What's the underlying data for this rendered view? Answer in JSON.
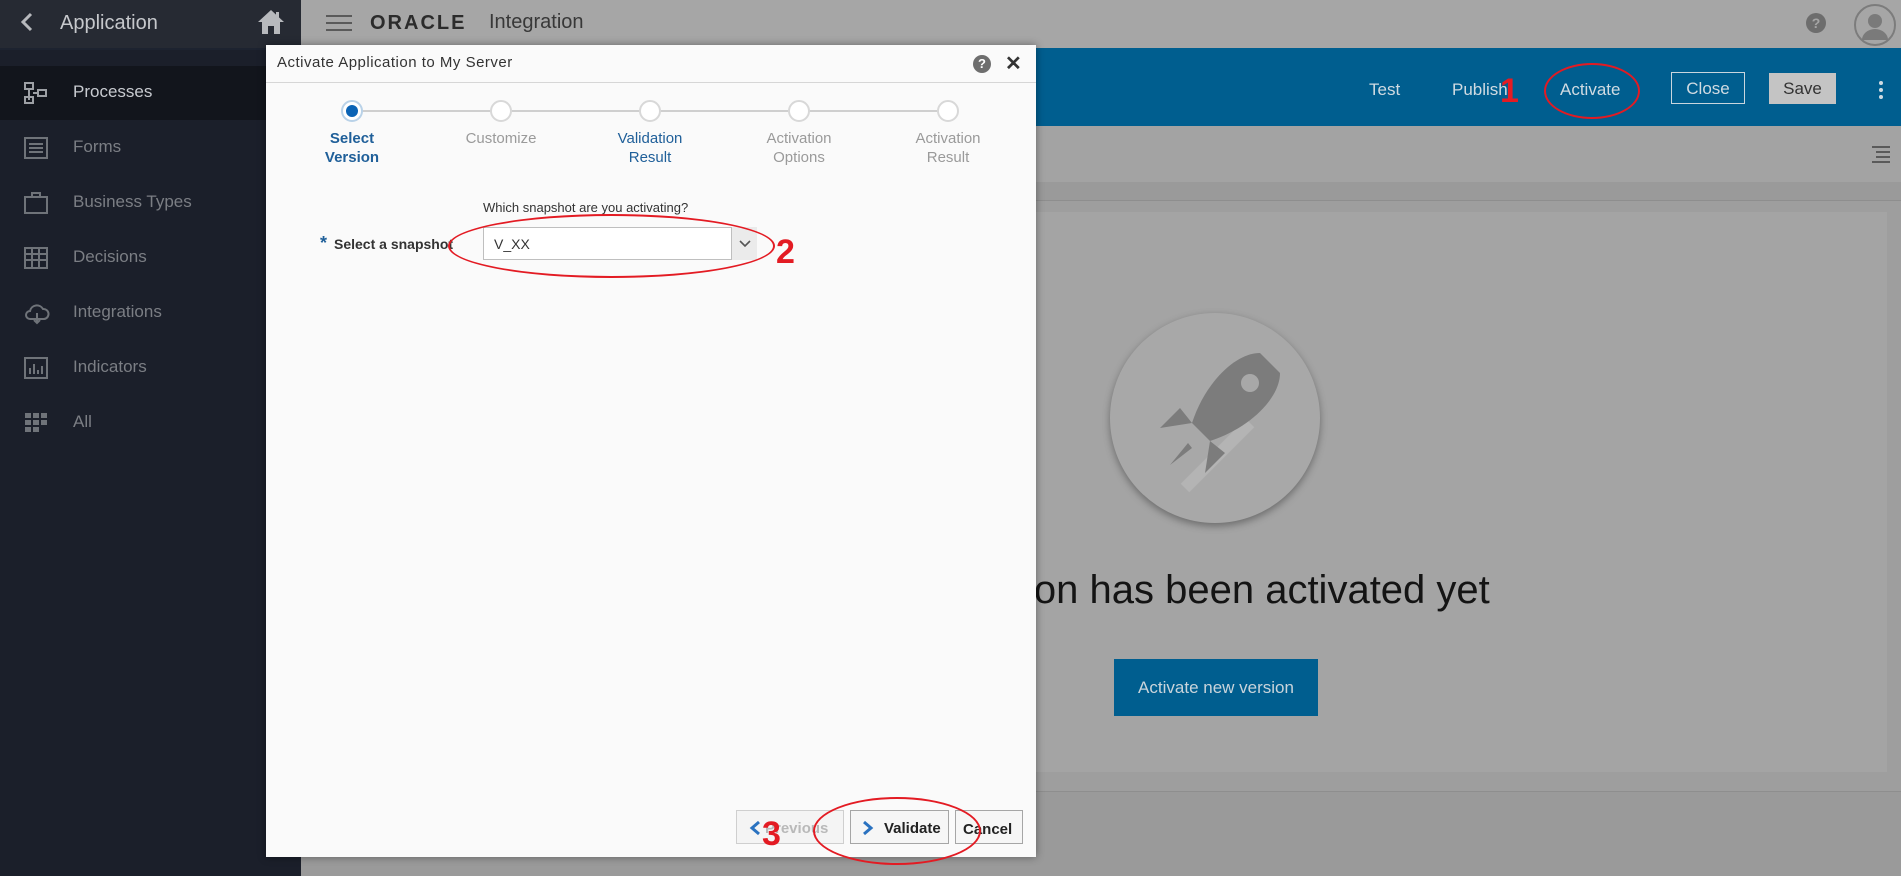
{
  "sidebar": {
    "title": "Application",
    "items": [
      {
        "label": "Processes",
        "icon": "processes-icon"
      },
      {
        "label": "Forms",
        "icon": "forms-icon"
      },
      {
        "label": "Business Types",
        "icon": "business-types-icon"
      },
      {
        "label": "Decisions",
        "icon": "decisions-icon"
      },
      {
        "label": "Integrations",
        "icon": "integrations-icon"
      },
      {
        "label": "Indicators",
        "icon": "indicators-icon"
      },
      {
        "label": "All",
        "icon": "all-icon"
      }
    ]
  },
  "topbar": {
    "logo": "ORACLE",
    "product": "Integration",
    "help": "?"
  },
  "actions": {
    "test": "Test",
    "publish": "Publish",
    "activate": "Activate",
    "close": "Close",
    "save": "Save"
  },
  "content": {
    "empty_message": "sion has been activated yet",
    "activate_new": "Activate new version"
  },
  "dialog": {
    "title": "Activate Application to My Server",
    "help": "?",
    "close": "✕",
    "steps": [
      {
        "line1": "Select",
        "line2": "Version"
      },
      {
        "line1": "Customize",
        "line2": ""
      },
      {
        "line1": "Validation",
        "line2": "Result"
      },
      {
        "line1": "Activation",
        "line2": "Options"
      },
      {
        "line1": "Activation",
        "line2": "Result"
      }
    ],
    "snapshot_hint": "Which snapshot are you activating?",
    "required_mark": "*",
    "snapshot_label": "Select a snapshot",
    "snapshot_value": "V_XX",
    "buttons": {
      "previous": "Previous",
      "validate": "Validate",
      "cancel": "Cancel"
    }
  },
  "annotations": {
    "one": "1",
    "two": "2",
    "three": "3"
  },
  "colors": {
    "accent": "#005e8f",
    "annotation": "#e31b23",
    "sidebar": "#1b1f2a"
  }
}
